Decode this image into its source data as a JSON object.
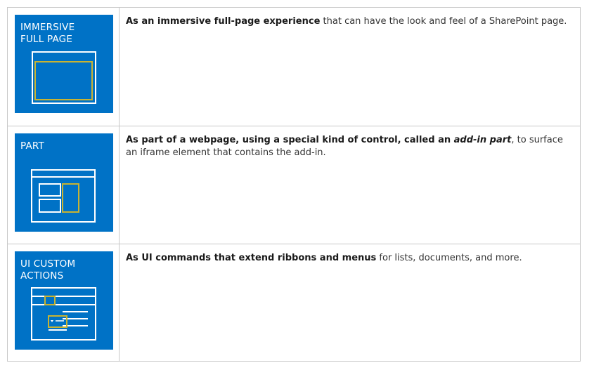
{
  "colors": {
    "tile_blue": "#0072c6",
    "accent_yellow": "#c8b332",
    "line_white": "#ffffff",
    "border": "#c8c8c8"
  },
  "rows": [
    {
      "tile_label": "IMMERSIVE\nFULL PAGE",
      "icon": "immersive-full-page-icon",
      "bold": "As an immersive full-page experience",
      "italic": "",
      "bold_after": "",
      "rest": " that can have the look and feel of a SharePoint page."
    },
    {
      "tile_label": "PART",
      "icon": "add-in-part-icon",
      "bold": "As part of a webpage, using a special kind of control, called an ",
      "italic": "add-in part",
      "bold_after": "",
      "rest": ", to surface an iframe element that contains the add-in."
    },
    {
      "tile_label": "UI CUSTOM\nACTIONS",
      "icon": "ui-custom-actions-icon",
      "bold": "As UI commands that extend ribbons and menus",
      "italic": "",
      "bold_after": "",
      "rest": " for lists, documents, and more."
    }
  ]
}
